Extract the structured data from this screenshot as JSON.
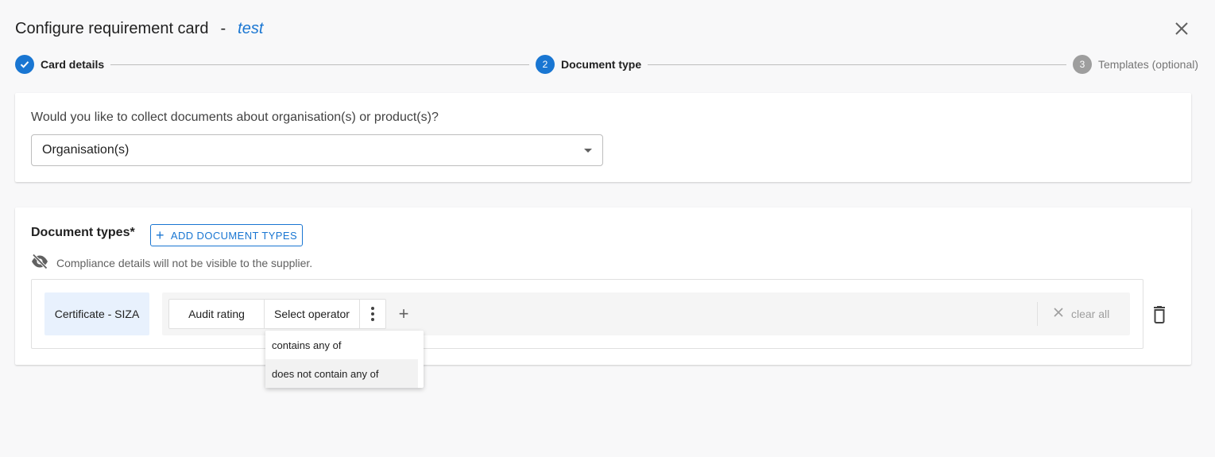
{
  "header": {
    "title": "Configure requirement card",
    "separator": "-",
    "card_name": "test"
  },
  "stepper": {
    "steps": [
      {
        "label": "Card details",
        "state": "done",
        "number": "1"
      },
      {
        "label": "Document type",
        "state": "active",
        "number": "2"
      },
      {
        "label": "Templates (optional)",
        "state": "pending",
        "number": "3"
      }
    ]
  },
  "collect": {
    "question": "Would you like to collect documents about organisation(s) or product(s)?",
    "selected": "Organisation(s)"
  },
  "documents": {
    "title": "Document types*",
    "add_button_label": "ADD DOCUMENT TYPES",
    "visibility_note": "Compliance details will not be visible to the supplier.",
    "rule": {
      "document_type": "Certificate - SIZA",
      "attribute": "Audit rating",
      "operator_placeholder": "Select operator",
      "clear_all_label": "clear all"
    }
  },
  "operator_dropdown": {
    "options": [
      "contains any of",
      "does not contain any of"
    ],
    "hovered_index": 1
  },
  "colors": {
    "accent": "#1976d2",
    "chip_bg": "#e8f1fd",
    "pending_step": "#9e9e9e"
  }
}
